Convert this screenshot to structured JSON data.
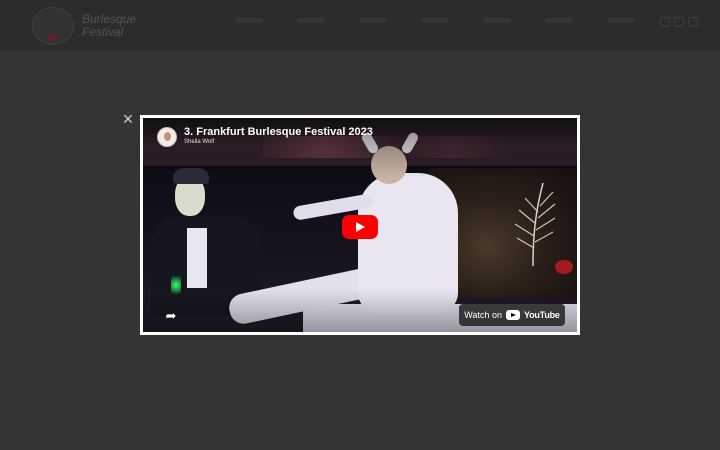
{
  "site": {
    "logo_text": "Burlesque Festival"
  },
  "lightbox": {
    "close_label": "×"
  },
  "video": {
    "title": "3. Frankfurt Burlesque Festival 2023",
    "channel": "Sheila Wolf",
    "watch_on_label": "Watch on",
    "platform_label": "YouTube",
    "share_glyph": "➦"
  },
  "colors": {
    "overlay_bg": "#3b3b3b",
    "play_button": "#ff0000",
    "frame": "#ffffff"
  },
  "icons": [
    "close-icon",
    "play-icon",
    "share-icon",
    "youtube-logo-icon",
    "channel-avatar"
  ]
}
